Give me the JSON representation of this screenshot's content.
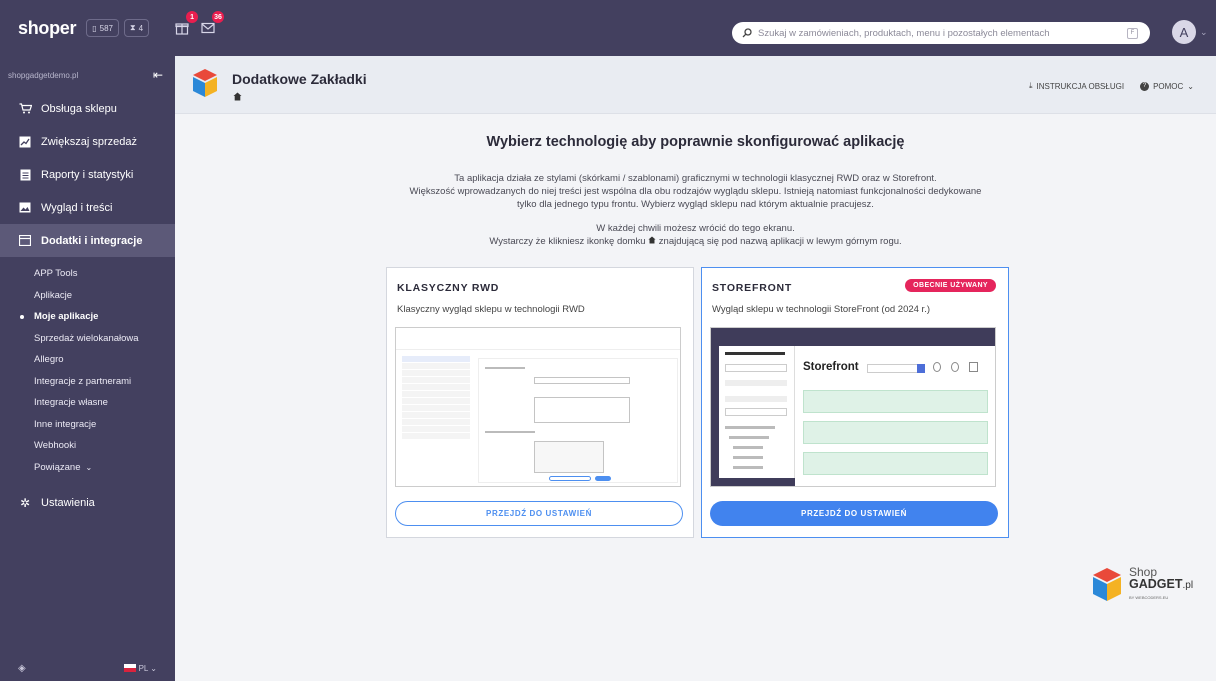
{
  "topbar": {
    "logo": "shoper",
    "orders_count": "587",
    "hourglass_count": "4",
    "gift_notifications": "1",
    "mail_notifications": "36",
    "search_placeholder": "Szukaj w zamówieniach, produktach, menu i pozostałych elementach",
    "avatar_letter": "A"
  },
  "sidebar": {
    "shop_name": "shopgadgetdemo.pl",
    "items": [
      {
        "label": "Obsługa sklepu",
        "icon": "cart-icon"
      },
      {
        "label": "Zwiększaj sprzedaż",
        "icon": "chart-icon"
      },
      {
        "label": "Raporty i statystyki",
        "icon": "report-icon"
      },
      {
        "label": "Wygląd i treści",
        "icon": "image-icon"
      },
      {
        "label": "Dodatki i integracje",
        "icon": "apps-icon"
      }
    ],
    "sub_items": [
      "APP Tools",
      "Aplikacje",
      "Moje aplikacje",
      "Sprzedaż wielokanałowa",
      "Allegro",
      "Integracje z partnerami",
      "Integracje własne",
      "Inne integracje",
      "Webhooki",
      "Powiązane"
    ],
    "settings_label": "Ustawienia",
    "language": "PL"
  },
  "header": {
    "title": "Dodatkowe Zakładki",
    "manual_link": "INSTRUKCJA OBSŁUGI",
    "help_link": "POMOC"
  },
  "main": {
    "heading": "Wybierz technologię aby poprawnie skonfigurować aplikację",
    "desc_line1": "Ta aplikacja działa ze stylami (skórkami / szablonami) graficznymi w technologii klasycznej RWD oraz w Storefront.",
    "desc_line2": "Większość wprowadzanych do niej treści jest wspólna dla obu rodzajów wyglądu sklepu. Istnieją natomiast funkcjonalności dedykowane",
    "desc_line3": "tylko dla jednego typu frontu. Wybierz wygląd sklepu nad którym aktualnie pracujesz.",
    "note_line1": "W każdej chwili możesz wrócić do tego ekranu.",
    "note_line2a": "Wystarczy że klikniesz ikonkę domku",
    "note_line2b": "znajdującą się pod nazwą aplikacji w lewym górnym rogu.",
    "cards": [
      {
        "title": "KLASYCZNY RWD",
        "description": "Klasyczny wygląd sklepu w technologii RWD",
        "button": "PRZEJDŹ DO USTAWIEŃ"
      },
      {
        "title": "STOREFRONT",
        "badge": "OBECNIE UŻYWANY",
        "description": "Wygląd sklepu w technologii StoreFront (od 2024 r.)",
        "button": "PRZEJDŹ DO USTAWIEŃ",
        "preview_title": "Storefront"
      }
    ]
  },
  "brand": {
    "line1": "Shop",
    "line2": "GADGET",
    "suffix": ".pl",
    "line3": "BY WEBCODERS.EU"
  }
}
